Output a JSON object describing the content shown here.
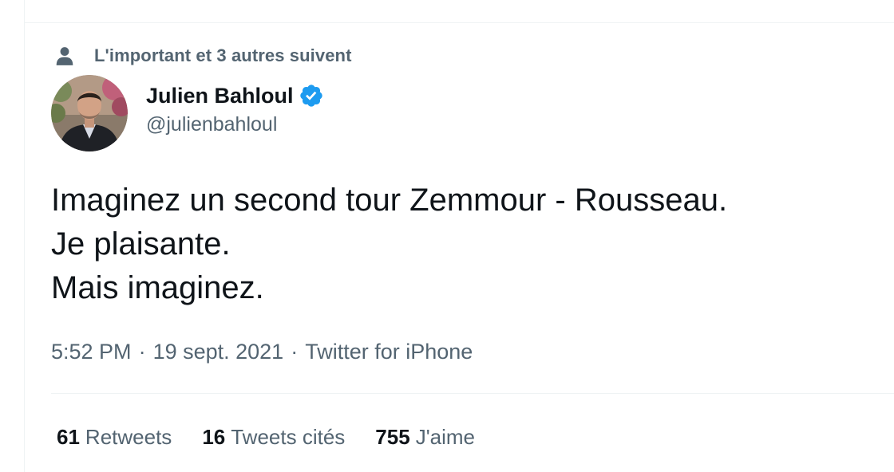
{
  "social_context": {
    "text": "L'important et 3 autres suivent",
    "icon": "person-icon"
  },
  "author": {
    "display_name": "Julien Bahloul",
    "handle": "@julienbahloul",
    "verified_icon": "verified-badge-icon",
    "verified_color": "#1d9bf0"
  },
  "tweet": {
    "lines": [
      "Imaginez un second tour Zemmour - Rousseau.",
      "Je plaisante.",
      "Mais imaginez."
    ],
    "time": "5:52 PM",
    "date": "19 sept. 2021",
    "source": "Twitter for iPhone",
    "separator": "·"
  },
  "stats": {
    "retweets_count": "61",
    "retweets_label": "Retweets",
    "quotes_count": "16",
    "quotes_label": "Tweets cités",
    "likes_count": "755",
    "likes_label": "J'aime"
  },
  "colors": {
    "text_primary": "#0f1419",
    "text_secondary": "#536471",
    "divider": "#eff3f4"
  }
}
